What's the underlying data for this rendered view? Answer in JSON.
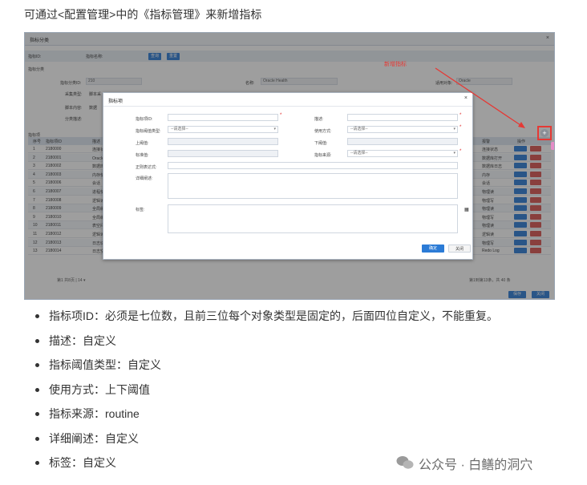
{
  "intro": "可通过<配置管理>中的《指标管理》来新增指标",
  "screenshot": {
    "window_title": "指标分类",
    "filter": {
      "id_label": "指标ID:",
      "name_label": "指标名称:",
      "query_btn": "查询",
      "reset_btn": "重置"
    },
    "category_section": "指标分类",
    "category_id_label": "指标分类ID:",
    "category_id_value": "210",
    "name_label": "名称:",
    "name_value": "Oracle Health",
    "applicable_label": "适用对象:",
    "applicable_value": "Oracle",
    "collect_type_label": "采集类型:",
    "collect_type_value": "脚本采",
    "script_label": "脚本内容:",
    "script_value": "数据",
    "desc_label": "分类描述:",
    "list_section": "指标项",
    "table": {
      "headers": [
        "序号",
        "指标项ID",
        "描述",
        "报警",
        "操作"
      ],
      "rows": [
        {
          "no": "1",
          "id": "2180000",
          "desc": "连接状态",
          "right": "连接状态"
        },
        {
          "no": "2",
          "id": "2180001",
          "desc": "Oracle数据库打开",
          "right": "数据库打开"
        },
        {
          "no": "3",
          "id": "2180002",
          "desc": "数据库日志错误",
          "right": "数据库日志"
        },
        {
          "no": "4",
          "id": "2180003",
          "desc": "内存使用",
          "right": "内存"
        },
        {
          "no": "5",
          "id": "2180006",
          "desc": "会话",
          "right": "会话"
        },
        {
          "no": "6",
          "id": "2180007",
          "desc": "进程使用",
          "right": "物理读"
        },
        {
          "no": "7",
          "id": "2180008",
          "desc": "逻辑读",
          "right": "物理写"
        },
        {
          "no": "8",
          "id": "2180009",
          "desc": "全局缓存读",
          "right": "物理读"
        },
        {
          "no": "9",
          "id": "2180010",
          "desc": "全局缓存写",
          "right": "物理写"
        },
        {
          "no": "10",
          "id": "2180011",
          "desc": "表空间使用",
          "right": "物理读"
        },
        {
          "no": "11",
          "id": "2180012",
          "desc": "逻辑读",
          "right": "逻辑读"
        },
        {
          "no": "12",
          "id": "2180013",
          "desc": "日志切换",
          "right": "物理写"
        },
        {
          "no": "13",
          "id": "2180014",
          "desc": "日志空间计数器计值",
          "mid1": "上下阈值",
          "mid2": "collector",
          "mid3": "日志空间计数器计值",
          "right": "Redo Log"
        }
      ]
    },
    "pager": {
      "info": "第1 共8页 | 14 ▾",
      "total": "第1到第13条，共 40 条"
    },
    "footer_btn_save": "保存",
    "footer_btn_close": "关闭",
    "dialog": {
      "title": "指标项",
      "id_label": "指标项ID:",
      "desc_label": "描述:",
      "threshold_type_label": "指标阈值类型:",
      "threshold_type_value": "--请选择--",
      "usage_label": "使用方式:",
      "usage_value": "--请选择--",
      "upper_label": "上阈值:",
      "lower_label": "下阈值:",
      "std_label": "标准值:",
      "source_label": "指标来源:",
      "source_value": "--请选择--",
      "regex_label": "正则表达式:",
      "detail_label": "详细阐述:",
      "tag_label": "标签:",
      "confirm_btn": "确定",
      "cancel_btn": "关闭"
    },
    "annotation": "新增指标"
  },
  "bullets": [
    "指标项ID：必须是七位数，且前三位每个对象类型是固定的，后面四位自定义，不能重复。",
    "描述：自定义",
    "指标阈值类型：自定义",
    "使用方式：上下阈值",
    "指标来源：routine",
    "详细阐述：自定义",
    "标签：自定义"
  ],
  "watermark": "公众号 · 白鳝的洞穴",
  "colors": {
    "primary": "#2b7bd6",
    "danger": "#d9534f",
    "annotation": "#e53935"
  }
}
